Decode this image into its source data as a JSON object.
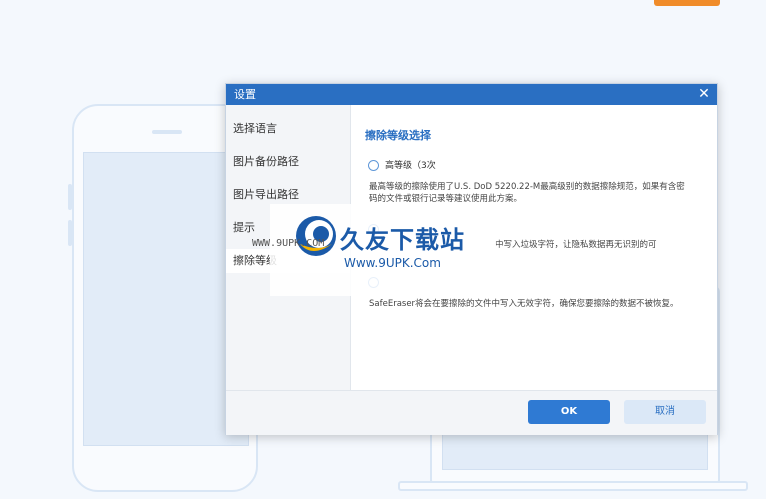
{
  "dialog": {
    "title": "设置",
    "close_glyph": "✕"
  },
  "sidebar": {
    "items": [
      {
        "label": "选择语言"
      },
      {
        "label": "图片备份路径"
      },
      {
        "label": "图片导出路径"
      },
      {
        "label": "提示"
      },
      {
        "label": "擦除等级"
      }
    ],
    "active_index": 4
  },
  "content": {
    "section_title": "擦除等级选择",
    "high": {
      "label": "高等级（3次",
      "description": "最高等级的擦除使用了U.S. DoD 5220.22-M最高级别的数据擦除规范，如果有含密码的文件或银行记录等建议使用此方案。"
    },
    "medium": {
      "fragment": "中写入垃圾字符，让隐私数据再无识别的可"
    },
    "low": {
      "description": "SafeEraser将会在要擦除的文件中写入无效字符，确保您要擦除的数据不被恢复。"
    }
  },
  "footer": {
    "ok_label": "OK",
    "cancel_label": "取消"
  },
  "watermark": {
    "title": "久友下载站",
    "url": "Www.9UPK.Com",
    "side_url": "WWW.9UPK.COM"
  },
  "colors": {
    "accent": "#2a6fc2",
    "ok_button": "#2f7ad3",
    "cancel_button": "#dbe8f7",
    "top_button": "#f08c2a"
  },
  "icons": {
    "close": "close-icon",
    "logo": "9upk-logo"
  }
}
